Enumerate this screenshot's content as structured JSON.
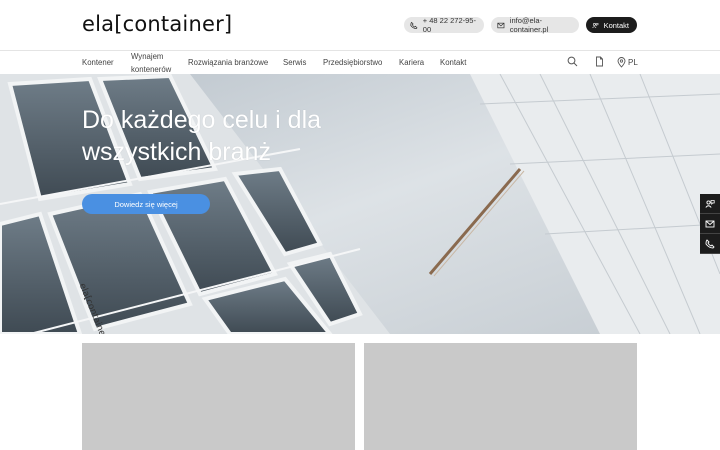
{
  "header": {
    "logo": "ela[container]",
    "phone": "+ 48 22 272-95-00",
    "email": "info@ela-container.pl",
    "contact_label": "Kontakt"
  },
  "nav": {
    "items": [
      {
        "label": "Kontener"
      },
      {
        "label": "Wynajem",
        "label2": "kontenerów"
      },
      {
        "label": "Rozwiązania branżowe"
      },
      {
        "label": "Serwis"
      },
      {
        "label": "Przedsiębiorstwo"
      },
      {
        "label": "Kariera"
      },
      {
        "label": "Kontakt"
      }
    ],
    "language": "PL"
  },
  "hero": {
    "title_line1": "Do każdego celu i dla",
    "title_line2": "wszystkich branż",
    "button_label": "Dowiedz się więcej",
    "container_brand": "ela[container]"
  },
  "colors": {
    "accent": "#4a90e2",
    "dark": "#1c1c1c",
    "pill_gray": "#e6e6e6",
    "card_gray": "#c9c9c9"
  }
}
